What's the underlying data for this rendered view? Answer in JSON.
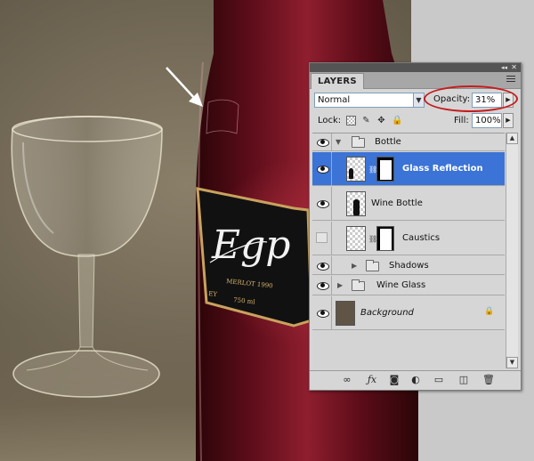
{
  "panel": {
    "tab_label": "LAYERS",
    "blend_mode": "Normal",
    "opacity_label": "Opacity:",
    "opacity_value": "31%",
    "lock_label": "Lock:",
    "fill_label": "Fill:",
    "fill_value": "100%"
  },
  "label_text": {
    "brand_script": "Egp",
    "wine_type": "MERLOT 1990",
    "left_fragment": "EY",
    "volume": "750 ml"
  },
  "layers": [
    {
      "name": "Bottle",
      "kind": "group",
      "expanded": true,
      "visible": true
    },
    {
      "name": "Glass Reflection",
      "kind": "layer",
      "selected": true,
      "visible": true,
      "has_mask": true
    },
    {
      "name": "Wine Bottle",
      "kind": "layer",
      "visible": true
    },
    {
      "name": "Caustics",
      "kind": "layer",
      "visible": false,
      "has_mask": true
    },
    {
      "name": "Shadows",
      "kind": "group",
      "expanded": false,
      "visible": true
    },
    {
      "name": "Wine Glass",
      "kind": "group",
      "expanded": false,
      "visible": true
    },
    {
      "name": "Background",
      "kind": "background",
      "visible": true,
      "locked": true
    }
  ],
  "colors": {
    "selection": "#3b73d6",
    "highlight_ellipse": "#c51d1d",
    "bottle": "#6b1020",
    "label": "#111111",
    "label_border": "#c9a25e"
  },
  "icons": [
    "link-layers-icon",
    "fx-icon",
    "add-mask-icon",
    "adjustment-layer-icon",
    "new-group-icon",
    "new-layer-icon",
    "delete-layer-icon"
  ]
}
